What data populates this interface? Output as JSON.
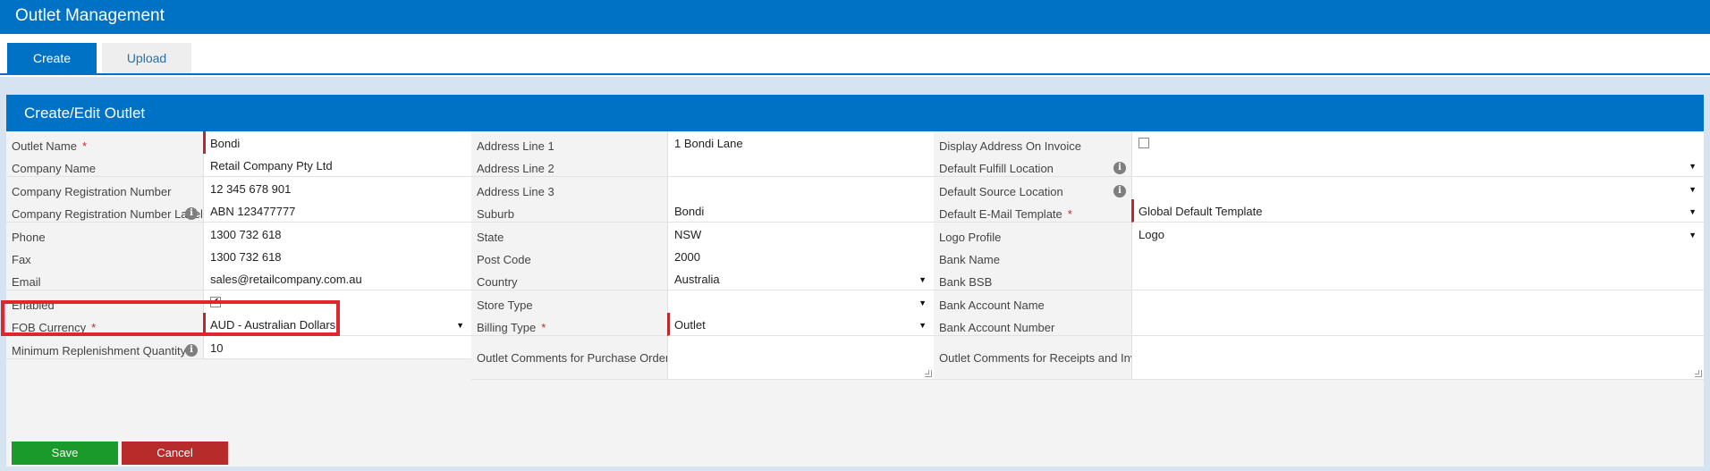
{
  "header": {
    "title": "Outlet Management"
  },
  "tabs": [
    {
      "label": "Create",
      "active": true
    },
    {
      "label": "Upload",
      "active": false
    }
  ],
  "panel": {
    "title": "Create/Edit Outlet"
  },
  "colors": {
    "primary": "#0072c6",
    "required": "#c0272d",
    "save": "#1a9a2a",
    "cancel": "#b72b2b",
    "highlight": "#e0262b"
  },
  "col1": [
    {
      "label": "Outlet Name",
      "required": true,
      "value": "Bondi"
    },
    {
      "label": "Company Name",
      "value": "Retail Company Pty Ltd"
    },
    {
      "label": "Company Registration Number",
      "value": "12 345 678 901"
    },
    {
      "label": "Company Registration Number Label",
      "info": true,
      "value": "ABN 123477777"
    },
    {
      "label": "Phone",
      "value": "1300 732 618"
    },
    {
      "label": "Fax",
      "value": "1300 732 618"
    },
    {
      "label": "Email",
      "value": "sales@retailcompany.com.au"
    },
    {
      "label": "Enabled",
      "checkbox": true,
      "checked": true,
      "check_mark": "✔"
    },
    {
      "label": "FOB Currency",
      "required": true,
      "value": "AUD - Australian Dollars",
      "select": true
    },
    {
      "label": "Minimum Replenishment Quantity",
      "info": true,
      "value": "10"
    }
  ],
  "col2": [
    {
      "label": "Address Line 1",
      "value": "1 Bondi Lane"
    },
    {
      "label": "Address Line 2",
      "value": ""
    },
    {
      "label": "Address Line 3",
      "value": ""
    },
    {
      "label": "Suburb",
      "value": "Bondi"
    },
    {
      "label": "State",
      "value": "NSW"
    },
    {
      "label": "Post Code",
      "value": "2000"
    },
    {
      "label": "Country",
      "value": "Australia",
      "select": true
    },
    {
      "label": "Store Type",
      "value": "",
      "select": true
    },
    {
      "label": "Billing Type",
      "required": true,
      "value": "Outlet",
      "select": true
    },
    {
      "label": "Outlet Comments for Purchase Orders",
      "value": "",
      "textarea": true
    }
  ],
  "col3": [
    {
      "label": "Display Address On Invoice",
      "checkbox": true,
      "checked": false
    },
    {
      "label": "Default Fulfill Location",
      "info": true,
      "value": "",
      "select": true
    },
    {
      "label": "Default Source Location",
      "info": true,
      "value": "",
      "select": true
    },
    {
      "label": "Default E-Mail Template",
      "required": true,
      "value": "Global Default Template",
      "select": true
    },
    {
      "label": "Logo Profile",
      "value": "Logo",
      "select": true
    },
    {
      "label": "Bank Name",
      "value": ""
    },
    {
      "label": "Bank BSB",
      "value": ""
    },
    {
      "label": "Bank Account Name",
      "value": ""
    },
    {
      "label": "Bank Account Number",
      "value": ""
    },
    {
      "label": "Outlet Comments for Receipts and Invoices",
      "value": "",
      "textarea": true
    }
  ],
  "buttons": {
    "save": "Save",
    "cancel": "Cancel"
  }
}
